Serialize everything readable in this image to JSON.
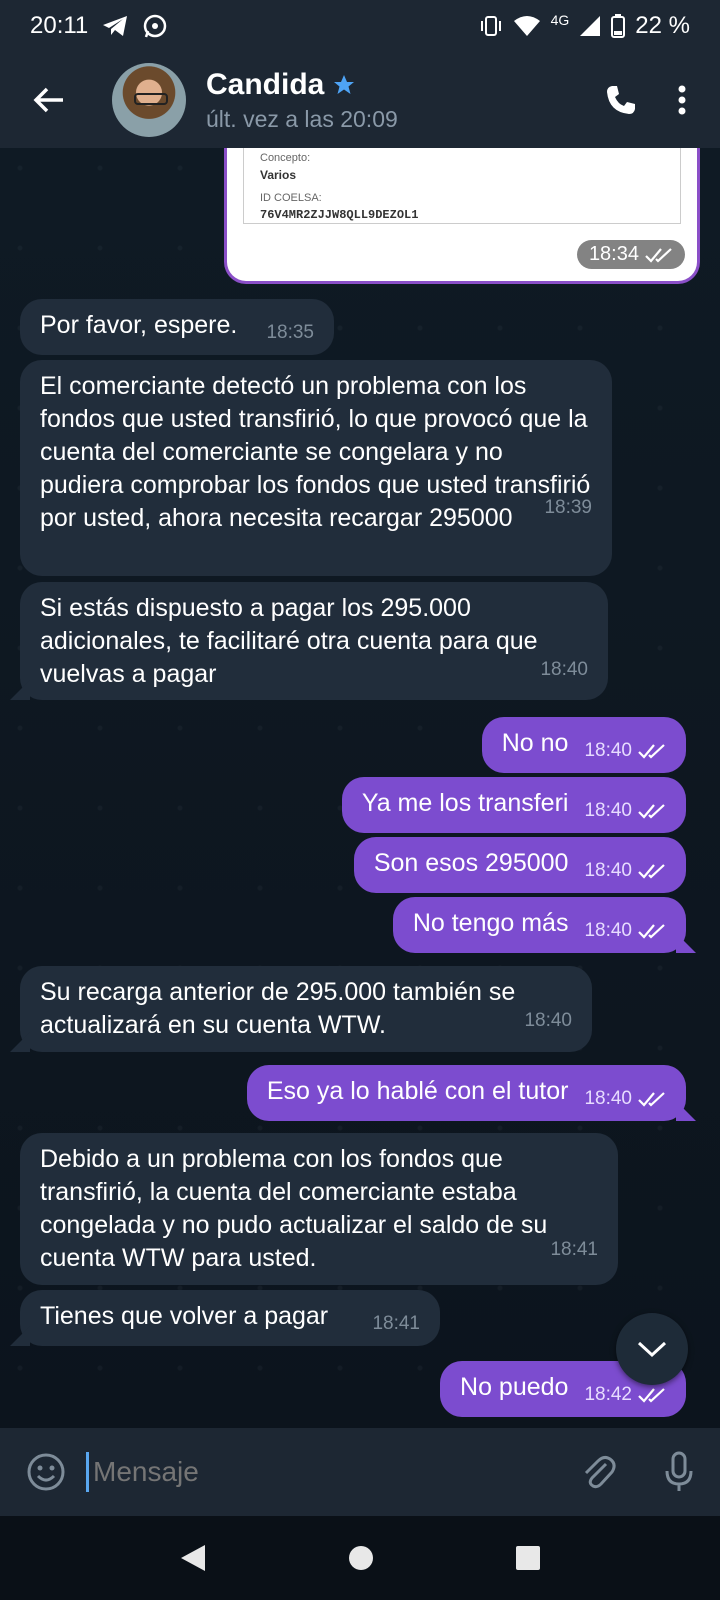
{
  "status": {
    "time": "20:11",
    "network": "4G",
    "battery": "22 %"
  },
  "contact": {
    "name": "Candida",
    "last_seen": "últ. vez a las 20:09"
  },
  "receipt": {
    "concept_label": "Concepto:",
    "concept_value": "Varios",
    "id_label": "ID COELSA:",
    "id_value": "76V4MR2ZJJW8QLL9DEZOL1",
    "time": "18:34"
  },
  "messages": [
    {
      "text": "Por favor, espere.",
      "time": "18:35"
    },
    {
      "text": "El comerciante detectó un problema con los fondos que usted transfirió, lo que provocó que la cuenta del comerciante se congelara y no pudiera comprobar los fondos que usted transfirió por usted, ahora necesita recargar 295000",
      "time": "18:39"
    },
    {
      "text": "Si estás dispuesto a pagar los 295.000 adicionales, te facilitaré otra cuenta para que vuelvas a pagar",
      "time": "18:40"
    },
    {
      "text": "No no",
      "time": "18:40"
    },
    {
      "text": "Ya me los transferi",
      "time": "18:40"
    },
    {
      "text": "Son esos 295000",
      "time": "18:40"
    },
    {
      "text": "No tengo más",
      "time": "18:40"
    },
    {
      "text": "Su recarga anterior de 295.000 también se actualizará en su cuenta WTW.",
      "time": "18:40"
    },
    {
      "text": "Eso ya lo hablé con el tutor",
      "time": "18:40"
    },
    {
      "text": "Debido a un problema con los fondos que transfirió, la cuenta del comerciante estaba congelada y no pudo actualizar el saldo de su cuenta WTW para usted.",
      "time": "18:41"
    },
    {
      "text": "Tienes que volver a pagar",
      "time": "18:41"
    },
    {
      "text": "No puedo",
      "time": "18:42"
    }
  ],
  "composer": {
    "placeholder": "Mensaje"
  },
  "colors": {
    "outgoing": "#7c4ccf",
    "incoming": "#212d3b",
    "background": "#0e1621",
    "header": "#1d2733"
  }
}
